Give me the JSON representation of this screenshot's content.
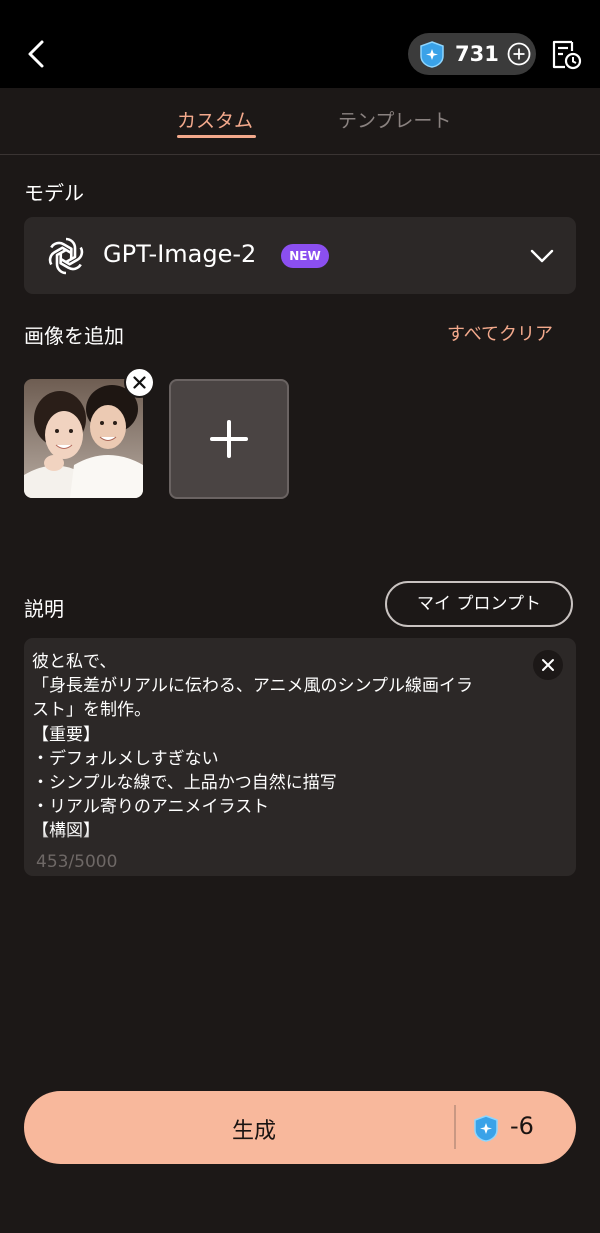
{
  "credits": {
    "value": "731"
  },
  "tabs": [
    {
      "label": "カスタム",
      "active": true
    },
    {
      "label": "テンプレート",
      "active": false
    }
  ],
  "model": {
    "section_label": "モデル",
    "name": "GPT-Image-2",
    "badge": "NEW"
  },
  "images": {
    "section_label": "画像を追加",
    "clear_all_label": "すべてクリア"
  },
  "description": {
    "section_label": "説明",
    "my_prompt_label": "マイ プロンプト",
    "text": "彼と私で、\n「身長差がリアルに伝わる、アニメ風のシンプル線画イラ\nスト」を制作。\n【重要】\n・デフォルメしすぎない\n・シンプルな線で、上品かつ自然に描写\n・リアル寄りのアニメイラスト\n【構図】\n・縦長ポスター風レイアウト",
    "counter": "453/5000"
  },
  "generate": {
    "label": "生成",
    "cost": "-6"
  },
  "colors": {
    "accent": "#f3a98c",
    "generate_button": "#f8b89c",
    "badge": "#8b4ff0",
    "background": "#1c1817",
    "panel": "#2c2827"
  }
}
